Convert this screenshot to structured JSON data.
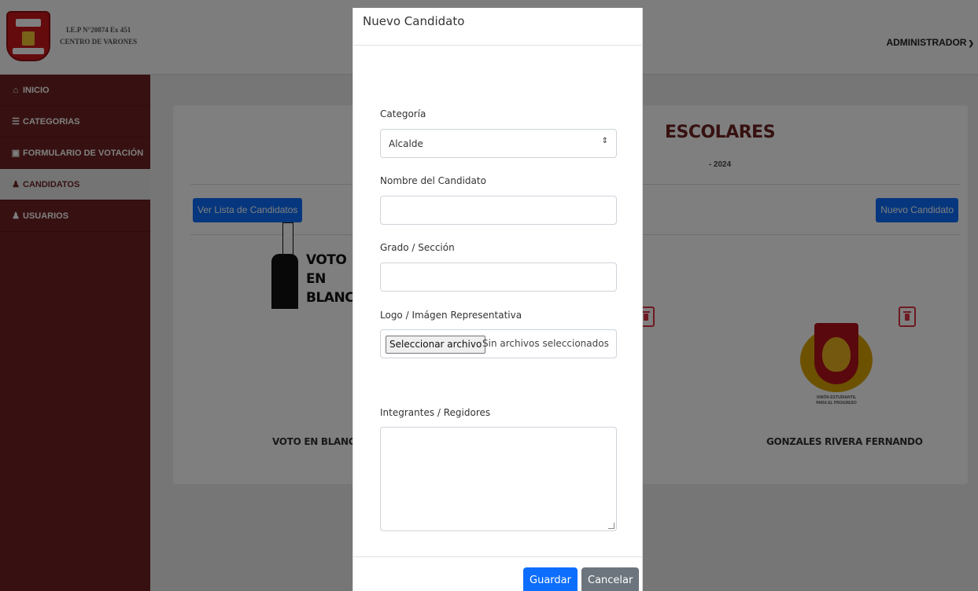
{
  "header": {
    "school_line1": "I.E.P N°20874 Ex 451",
    "school_line2": "CENTRO DE VARONES",
    "user_menu": "ADMINISTRADOR"
  },
  "sidebar": {
    "items": [
      {
        "label": "INICIO",
        "icon": "home-icon"
      },
      {
        "label": "CATEGORIAS",
        "icon": "list-icon"
      },
      {
        "label": "FORMULARIO DE VOTACIÓN",
        "icon": "form-icon"
      },
      {
        "label": "CANDIDATOS",
        "icon": "users-icon",
        "active": true
      },
      {
        "label": "USUARIOS",
        "icon": "group-icon"
      }
    ]
  },
  "main": {
    "title_visible": "ESCOLARES",
    "subtitle_visible": "- 2024",
    "list_button": "Ver Lista de Candidatos",
    "new_button": "Nuevo Candidato",
    "candidates": [
      {
        "name": "VOTO EN BLANCO",
        "image_text": [
          "VOTO",
          "EN",
          "BLANCO"
        ]
      },
      {
        "name": "GONZALES RIVERA FERNANDO",
        "logo_text": [
          "UNIÓN ESTUDIANTIL",
          "PARA EL PROGRESO"
        ]
      }
    ]
  },
  "modal": {
    "title": "Nuevo Candidato",
    "category_label": "Categoría",
    "category_value": "Alcalde",
    "name_label": "Nombre del Candidato",
    "name_value": "",
    "grade_label": "Grado / Sección",
    "grade_value": "",
    "logo_label": "Logo / Imágen Representativa",
    "file_button": "Seleccionar archivo",
    "file_status": "Sin archivos seleccionados",
    "members_label": "Integrantes / Regidores",
    "save_button": "Guardar",
    "cancel_button": "Cancelar"
  },
  "colors": {
    "sidebar": "#6f2222",
    "primary": "#0d6efd",
    "secondary": "#6c757d",
    "danger": "#dc3545"
  }
}
